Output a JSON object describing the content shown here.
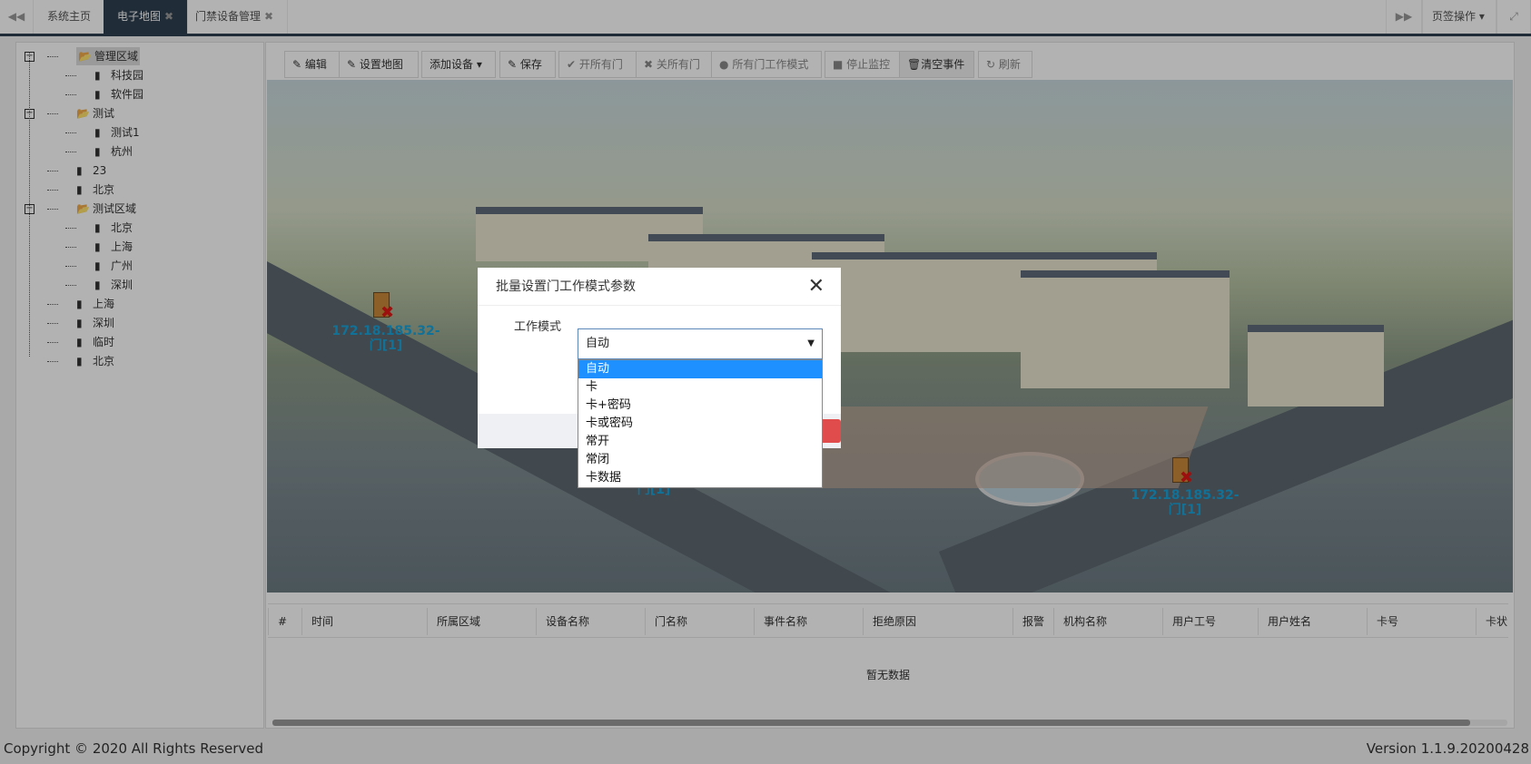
{
  "tabs": {
    "prev_icon": "double-left-icon",
    "items": [
      {
        "label": "系统主页",
        "closable": false
      },
      {
        "label": "电子地图",
        "closable": true,
        "active": true
      },
      {
        "label": "门禁设备管理",
        "closable": true
      }
    ],
    "close_glyph": "✖",
    "next_icon": "double-right-icon",
    "tab_ops": "页签操作",
    "fullscreen_icon": "expand-icon"
  },
  "tree": [
    {
      "label": "管理区域",
      "type": "folder",
      "level": 0,
      "expanded": true,
      "selected": true
    },
    {
      "label": "科技园",
      "type": "file",
      "level": 1
    },
    {
      "label": "软件园",
      "type": "file",
      "level": 1
    },
    {
      "label": "测试",
      "type": "folder",
      "level": 0,
      "expanded": true
    },
    {
      "label": "测试1",
      "type": "file",
      "level": 1
    },
    {
      "label": "杭州",
      "type": "file",
      "level": 1
    },
    {
      "label": "23",
      "type": "file",
      "level": 0
    },
    {
      "label": "北京",
      "type": "file",
      "level": 0
    },
    {
      "label": "测试区域",
      "type": "folder",
      "level": 0,
      "expanded": true
    },
    {
      "label": "北京",
      "type": "file",
      "level": 1
    },
    {
      "label": "上海",
      "type": "file",
      "level": 1
    },
    {
      "label": "广州",
      "type": "file",
      "level": 1
    },
    {
      "label": "深圳",
      "type": "file",
      "level": 1
    },
    {
      "label": "上海",
      "type": "file",
      "level": 0
    },
    {
      "label": "深圳",
      "type": "file",
      "level": 0
    },
    {
      "label": "临时",
      "type": "file",
      "level": 0
    },
    {
      "label": "北京",
      "type": "file",
      "level": 0
    }
  ],
  "toolbar": {
    "edit": "编辑",
    "set_map": "设置地图",
    "add_device": "添加设备",
    "save": "保存",
    "open_all": "开所有门",
    "close_all": "关所有门",
    "all_mode": "所有门工作模式",
    "stop_monitor": "停止监控",
    "clear_events": "清空事件",
    "refresh": "刷新"
  },
  "markers": [
    {
      "label": "172.18.185.32-",
      "door": "门[1]"
    },
    {
      "label": "172.18.185.32-",
      "door": "门[1]"
    },
    {
      "door": "门[1]"
    }
  ],
  "table": {
    "columns": [
      "#",
      "时间",
      "所属区域",
      "设备名称",
      "门名称",
      "事件名称",
      "拒绝原因",
      "报警",
      "机构名称",
      "用户工号",
      "用户姓名",
      "卡号",
      "卡状"
    ],
    "empty": "暂无数据"
  },
  "footer": {
    "copyright": "Copyright © 2020 All Rights Reserved",
    "version": "Version 1.1.9.20200428"
  },
  "dialog": {
    "title": "批量设置门工作模式参数",
    "field_label": "工作模式",
    "selected": "自动",
    "options": [
      "自动",
      "卡",
      "卡+密码",
      "卡或密码",
      "常开",
      "常闭",
      "卡数据"
    ]
  },
  "colors": {
    "accent": "#1e90ff",
    "tab_active": "#2f4050",
    "marker": "#1aa2d8"
  }
}
